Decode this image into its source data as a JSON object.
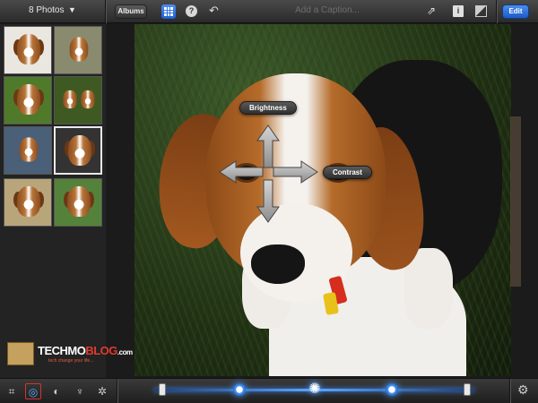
{
  "topbar": {
    "photos_count": "8 Photos",
    "albums_label": "Albums",
    "help_label": "?",
    "caption_placeholder": "Add a Caption...",
    "info_label": "i",
    "edit_label": "Edit"
  },
  "icons": {
    "dropdown": "chevron-down-icon",
    "grid": "grid-icon",
    "help": "help-icon",
    "undo": "undo-icon",
    "share": "share-icon",
    "info": "info-icon",
    "compare": "compare-icon",
    "crop": "crop-icon",
    "exposure": "exposure-icon",
    "color": "palette-icon",
    "brushes": "brushes-icon",
    "effects": "effects-icon",
    "settings": "gear-icon"
  },
  "thumbnails": [
    {
      "name": "thumb-1"
    },
    {
      "name": "thumb-2"
    },
    {
      "name": "thumb-3"
    },
    {
      "name": "thumb-4"
    },
    {
      "name": "thumb-5"
    },
    {
      "name": "thumb-6",
      "selected": true
    },
    {
      "name": "thumb-7"
    },
    {
      "name": "thumb-8"
    }
  ],
  "gestures": {
    "brightness_label": "Brightness",
    "contrast_label": "Contrast"
  },
  "watermark": {
    "techmo": "TECHMO",
    "blog": "BLOG",
    "com": ".com",
    "tagline": "tech change your life..."
  },
  "colors": {
    "accent_blue": "#2a6fe0",
    "active_tool_border": "#d93030"
  }
}
